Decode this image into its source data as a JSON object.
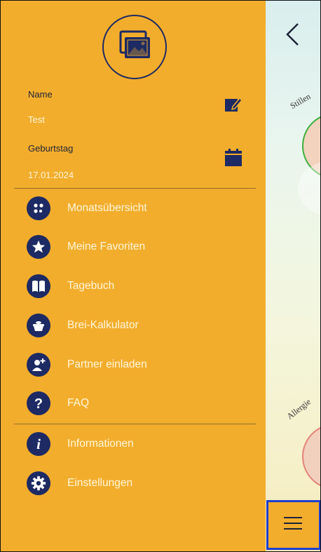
{
  "profile": {
    "name_label": "Name",
    "name_value": "Test",
    "birthday_label": "Geburtstag",
    "birthday_value": "17.01.2024"
  },
  "menu": {
    "items": [
      {
        "label": "Monatsübersicht",
        "icon": "dots-icon"
      },
      {
        "label": "Meine Favoriten",
        "icon": "star-icon"
      },
      {
        "label": "Tagebuch",
        "icon": "book-icon"
      },
      {
        "label": "Brei-Kalkulator",
        "icon": "pot-icon"
      },
      {
        "label": "Partner einladen",
        "icon": "add-person-icon"
      },
      {
        "label": "FAQ",
        "icon": "question-icon"
      }
    ],
    "secondary": [
      {
        "label": "Informationen",
        "icon": "info-icon"
      },
      {
        "label": "Einstellungen",
        "icon": "gear-icon"
      }
    ]
  },
  "background": {
    "tile_1_label": "Stillen",
    "tile_2_label": "Allergie"
  },
  "colors": {
    "drawer": "#f3ad2c",
    "icon": "#1d2a63",
    "highlight_border": "#1f3fcf"
  }
}
